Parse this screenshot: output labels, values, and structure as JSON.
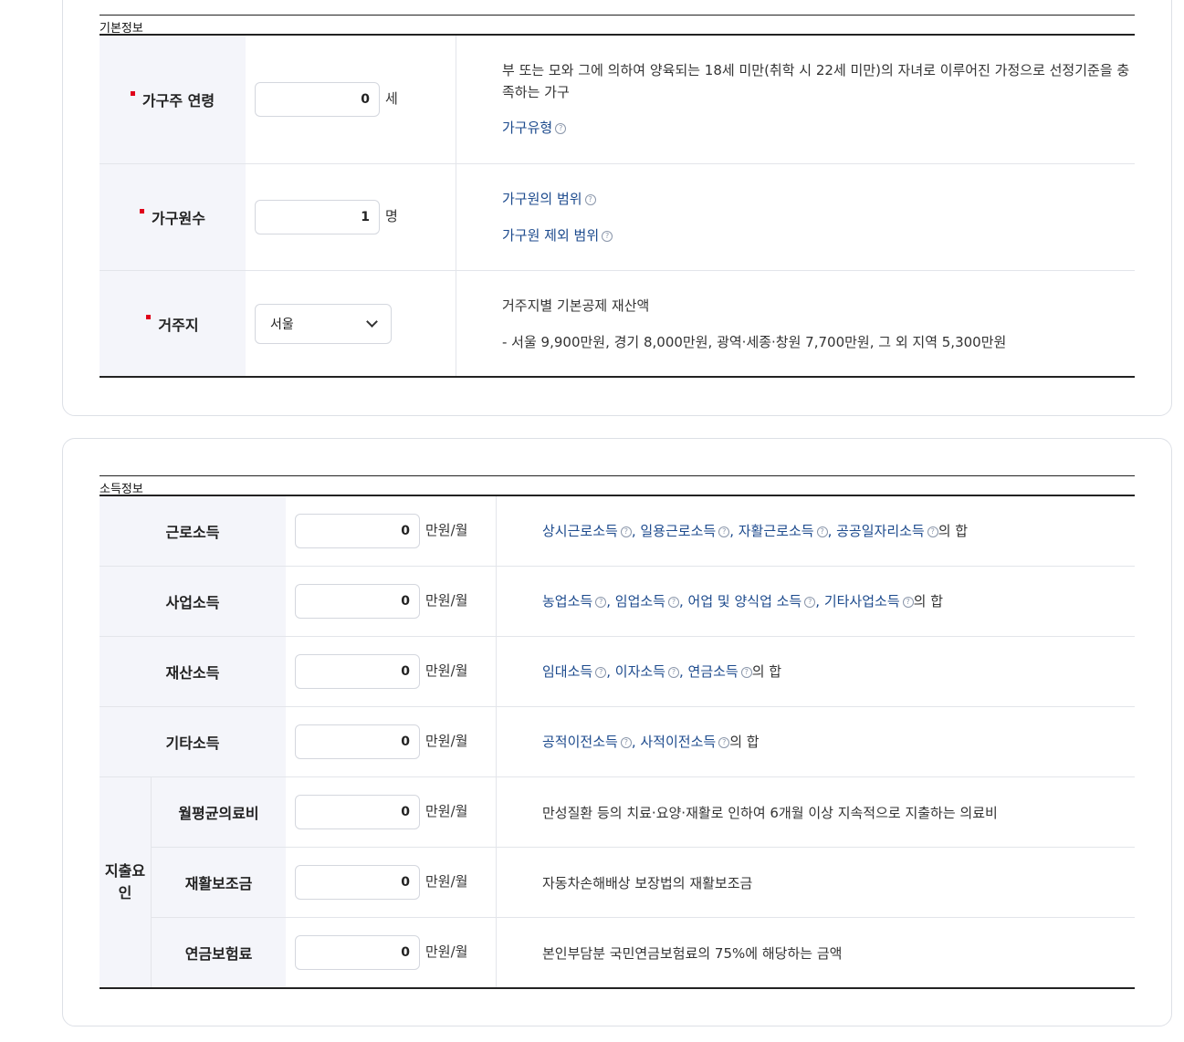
{
  "basic_info": {
    "title": "기본정보",
    "rows": [
      {
        "label": "가구주 연령",
        "value": "0",
        "unit": "세",
        "desc_text": "부 또는 모와 그에 의하여 양육되는 18세 미만(취학 시 22세 미만)의 자녀로 이루어진 가정으로 선정기준을 충족하는 가구",
        "links": [
          "가구유형"
        ]
      },
      {
        "label": "가구원수",
        "value": "1",
        "unit": "명",
        "links": [
          "가구원의 범위",
          "가구원 제외 범위"
        ]
      },
      {
        "label": "거주지",
        "select_value": "서울",
        "desc_line1": "거주지별 기본공제 재산액",
        "desc_line2": "- 서울 9,900만원, 경기 8,000만원, 광역·세종·창원 7,700만원, 그 외 지역 5,300만원"
      }
    ]
  },
  "income_info": {
    "title": "소득정보",
    "unit": "만원/월",
    "suffix": "의 합",
    "comma": ",",
    "expense_group_label": "지출요인",
    "rows": [
      {
        "label": "근로소득",
        "value": "0",
        "links": [
          "상시근로소득",
          "일용근로소득",
          "자활근로소득",
          "공공일자리소득"
        ]
      },
      {
        "label": "사업소득",
        "value": "0",
        "links": [
          "농업소득",
          "임업소득",
          "어업 및 양식업 소득",
          "기타사업소득"
        ]
      },
      {
        "label": "재산소득",
        "value": "0",
        "links": [
          "임대소득",
          "이자소득",
          "연금소득"
        ]
      },
      {
        "label": "기타소득",
        "value": "0",
        "links": [
          "공적이전소득",
          "사적이전소득"
        ]
      },
      {
        "label": "월평균의료비",
        "value": "0",
        "desc": "만성질환 등의 치료·요양·재활로 인하여 6개월 이상 지속적으로 지출하는 의료비"
      },
      {
        "label": "재활보조금",
        "value": "0",
        "desc": "자동차손해배상 보장법의 재활보조금"
      },
      {
        "label": "연금보험료",
        "value": "0",
        "desc": "본인부담분 국민연금보험료의 75%에 해당하는 금액"
      }
    ]
  },
  "icons": {
    "help": "question-circle-icon",
    "dropdown": "chevron-down-icon"
  },
  "colors": {
    "required_mark": "#e0001b",
    "link": "#1c4a8d",
    "header_bg": "#f4f5fa"
  }
}
